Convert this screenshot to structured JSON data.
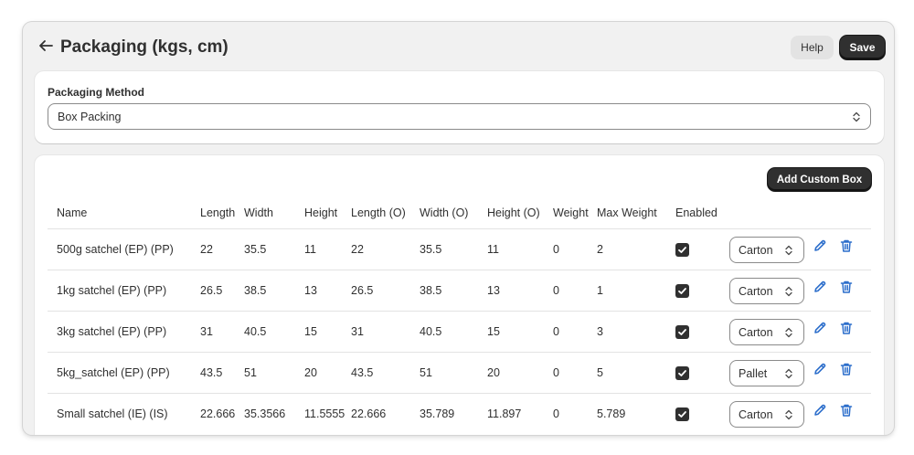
{
  "header": {
    "title": "Packaging (kgs, cm)",
    "help_label": "Help",
    "save_label": "Save"
  },
  "method": {
    "label": "Packaging Method",
    "value": "Box Packing"
  },
  "boxes": {
    "add_label": "Add Custom Box",
    "columns": [
      "Name",
      "Length",
      "Width",
      "Height",
      "Length (O)",
      "Width (O)",
      "Height (O)",
      "Weight",
      "Max Weight",
      "Enabled"
    ],
    "rows": [
      {
        "name": "500g satchel (EP) (PP)",
        "length": "22",
        "width": "35.5",
        "height": "11",
        "length_o": "22",
        "width_o": "35.5",
        "height_o": "11",
        "weight": "0",
        "max_weight": "2",
        "enabled": true,
        "type": "Carton"
      },
      {
        "name": "1kg satchel (EP) (PP)",
        "length": "26.5",
        "width": "38.5",
        "height": "13",
        "length_o": "26.5",
        "width_o": "38.5",
        "height_o": "13",
        "weight": "0",
        "max_weight": "1",
        "enabled": true,
        "type": "Carton"
      },
      {
        "name": "3kg satchel (EP) (PP)",
        "length": "31",
        "width": "40.5",
        "height": "15",
        "length_o": "31",
        "width_o": "40.5",
        "height_o": "15",
        "weight": "0",
        "max_weight": "3",
        "enabled": true,
        "type": "Carton"
      },
      {
        "name": "5kg_satchel (EP) (PP)",
        "length": "43.5",
        "width": "51",
        "height": "20",
        "length_o": "43.5",
        "width_o": "51",
        "height_o": "20",
        "weight": "0",
        "max_weight": "5",
        "enabled": true,
        "type": "Pallet"
      },
      {
        "name": "Small satchel (IE) (IS)",
        "length": "22.666",
        "width": "35.3566",
        "height": "11.5555",
        "length_o": "22.666",
        "width_o": "35.789",
        "height_o": "11.897",
        "weight": "0",
        "max_weight": "5.789",
        "enabled": true,
        "type": "Carton"
      }
    ]
  },
  "icons": {
    "back": "arrow-left-icon",
    "select": "chevron-up-down-icon",
    "enabled": "checkmark-icon",
    "edit": "pencil-icon",
    "delete": "trash-icon"
  },
  "colors": {
    "accent_dark": "#303030",
    "icon_blue": "#2c6ecb",
    "background": "#f1f1f1",
    "card": "#ffffff"
  }
}
